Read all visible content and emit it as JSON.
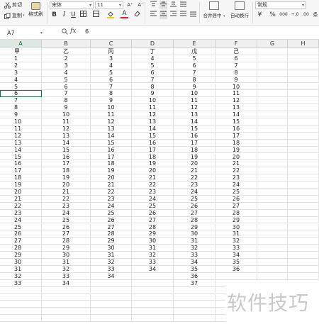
{
  "toolbar": {
    "cut_label": "剪切",
    "copy_label": "复制",
    "format_painter_label": "格式刷",
    "font_name": "宋体",
    "font_size": "11",
    "bold": "B",
    "italic": "I",
    "underline": "U",
    "increase_font": "A⁺",
    "decrease_font": "A⁻",
    "font_color_glyph": "A",
    "merge_center_label": "合并居中",
    "wrap_text_label": "自动换行",
    "number_format": "常规",
    "currency": "¥",
    "percent": "%",
    "thousands": "000",
    "inc_decimal": "+.0",
    "dec_decimal": ".00",
    "more_label": "条"
  },
  "formula_bar": {
    "cell_ref": "A7",
    "fx_label": "fx",
    "content": "6"
  },
  "columns": [
    "A",
    "B",
    "C",
    "D",
    "E",
    "F",
    "G",
    "H"
  ],
  "selected_column": "A",
  "active_cell": {
    "row": 6,
    "col": 0
  },
  "rows": [
    [
      "甲",
      "乙",
      "丙",
      "丁",
      "戊",
      "己",
      "",
      ""
    ],
    [
      "1",
      "2",
      "3",
      "4",
      "5",
      "6",
      "",
      ""
    ],
    [
      "2",
      "3",
      "4",
      "5",
      "6",
      "7",
      "",
      ""
    ],
    [
      "3",
      "4",
      "5",
      "6",
      "7",
      "8",
      "",
      ""
    ],
    [
      "4",
      "5",
      "6",
      "7",
      "8",
      "9",
      "",
      ""
    ],
    [
      "5",
      "6",
      "7",
      "8",
      "9",
      "10",
      "",
      ""
    ],
    [
      "6",
      "7",
      "8",
      "9",
      "10",
      "11",
      "",
      ""
    ],
    [
      "7",
      "8",
      "9",
      "10",
      "11",
      "12",
      "",
      ""
    ],
    [
      "8",
      "9",
      "10",
      "11",
      "12",
      "13",
      "",
      ""
    ],
    [
      "9",
      "10",
      "11",
      "12",
      "13",
      "14",
      "",
      ""
    ],
    [
      "10",
      "11",
      "12",
      "13",
      "14",
      "15",
      "",
      ""
    ],
    [
      "11",
      "12",
      "13",
      "14",
      "15",
      "16",
      "",
      ""
    ],
    [
      "12",
      "13",
      "14",
      "15",
      "16",
      "17",
      "",
      ""
    ],
    [
      "13",
      "14",
      "15",
      "16",
      "17",
      "18",
      "",
      ""
    ],
    [
      "14",
      "15",
      "16",
      "17",
      "18",
      "19",
      "",
      ""
    ],
    [
      "15",
      "16",
      "17",
      "18",
      "19",
      "20",
      "",
      ""
    ],
    [
      "16",
      "17",
      "18",
      "19",
      "20",
      "21",
      "",
      ""
    ],
    [
      "17",
      "18",
      "19",
      "20",
      "21",
      "22",
      "",
      ""
    ],
    [
      "18",
      "19",
      "20",
      "21",
      "22",
      "23",
      "",
      ""
    ],
    [
      "19",
      "20",
      "21",
      "22",
      "23",
      "24",
      "",
      ""
    ],
    [
      "20",
      "21",
      "22",
      "23",
      "24",
      "25",
      "",
      ""
    ],
    [
      "21",
      "22",
      "23",
      "24",
      "25",
      "26",
      "",
      ""
    ],
    [
      "22",
      "23",
      "24",
      "25",
      "26",
      "27",
      "",
      ""
    ],
    [
      "23",
      "24",
      "25",
      "26",
      "27",
      "28",
      "",
      ""
    ],
    [
      "24",
      "25",
      "26",
      "27",
      "28",
      "29",
      "",
      ""
    ],
    [
      "25",
      "26",
      "27",
      "28",
      "29",
      "30",
      "",
      ""
    ],
    [
      "26",
      "27",
      "28",
      "29",
      "30",
      "31",
      "",
      ""
    ],
    [
      "27",
      "28",
      "29",
      "30",
      "31",
      "32",
      "",
      ""
    ],
    [
      "28",
      "29",
      "30",
      "31",
      "32",
      "33",
      "",
      ""
    ],
    [
      "29",
      "30",
      "31",
      "32",
      "33",
      "34",
      "",
      ""
    ],
    [
      "30",
      "31",
      "32",
      "33",
      "34",
      "35",
      "",
      ""
    ],
    [
      "31",
      "32",
      "33",
      "34",
      "35",
      "36",
      "",
      ""
    ],
    [
      "32",
      "33",
      "34",
      "",
      "36",
      "",
      "",
      ""
    ],
    [
      "33",
      "34",
      "",
      "",
      "37",
      "",
      "",
      ""
    ],
    [
      "",
      "",
      "",
      "",
      "",
      "",
      "",
      ""
    ],
    [
      "",
      "",
      "",
      "",
      "",
      "",
      "",
      ""
    ],
    [
      "",
      "",
      "",
      "",
      "",
      "",
      "",
      ""
    ],
    [
      "",
      "",
      "",
      "",
      "",
      "",
      "",
      ""
    ],
    [
      "",
      "",
      "",
      "",
      "",
      "",
      "",
      ""
    ]
  ],
  "watermark": "软件技巧",
  "colors": {
    "selection": "#1e7145",
    "header_bg": "#f0f0f0",
    "grid": "#e2e2e2"
  }
}
